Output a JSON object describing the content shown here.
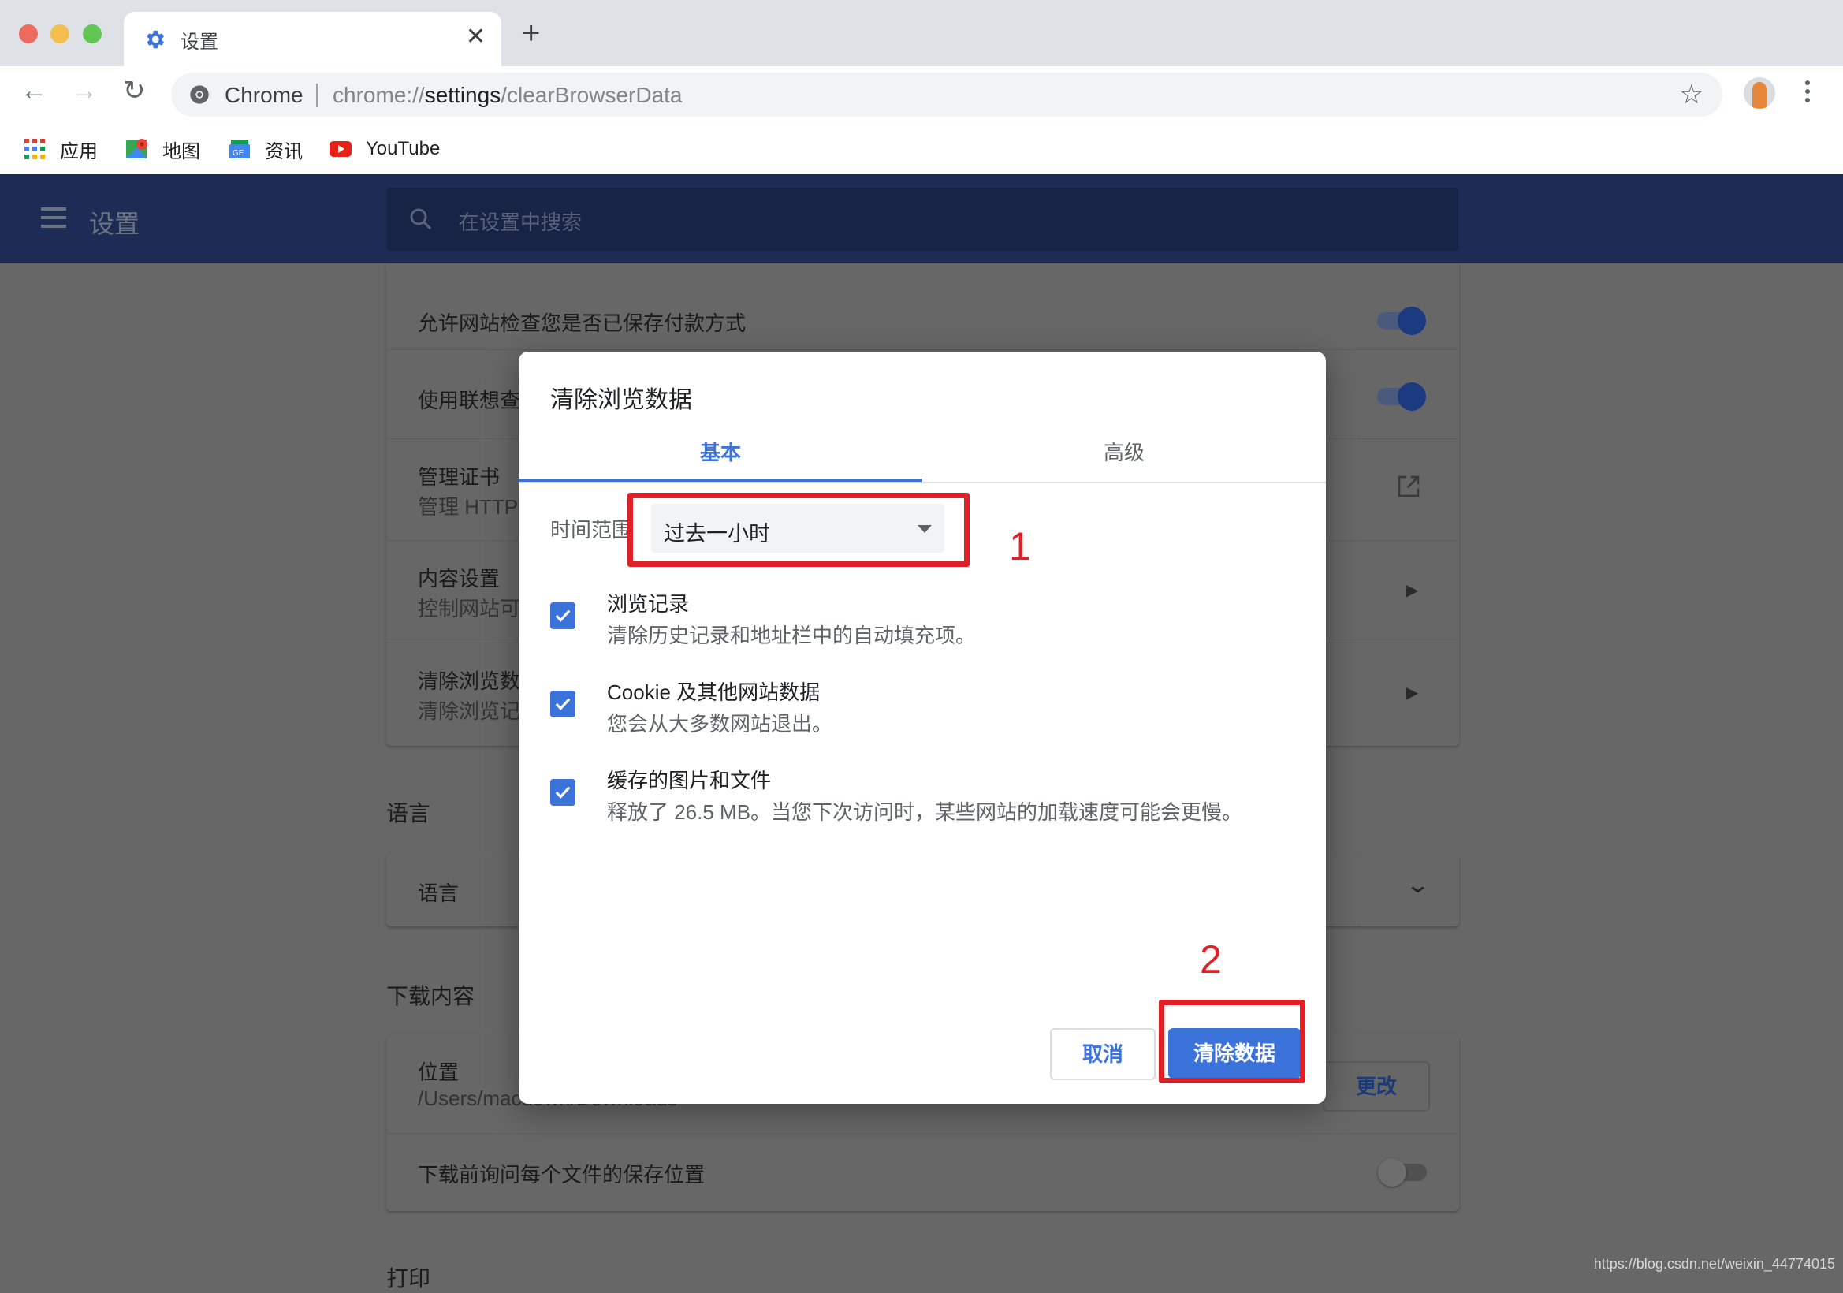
{
  "browser": {
    "tab": {
      "title": "设置",
      "icon": "gear-icon"
    },
    "new_tab_label": "+",
    "omnibox": {
      "site_label": "Chrome",
      "url_prefix": "chrome://",
      "url_host": "settings",
      "url_path": "/clearBrowserData"
    },
    "bookmarks": [
      {
        "label": "应用",
        "icon": "apps-grid-icon"
      },
      {
        "label": "地图",
        "icon": "maps-icon"
      },
      {
        "label": "资讯",
        "icon": "news-icon"
      },
      {
        "label": "YouTube",
        "icon": "youtube-icon"
      }
    ]
  },
  "settings": {
    "title": "设置",
    "search_placeholder": "在设置中搜索",
    "privacy_rows": [
      {
        "title": "允许网站检查您是否已保存付款方式",
        "control": "toggle",
        "on": true
      },
      {
        "title": "使用联想查询服务帮助完成搜索和网址",
        "control": "toggle",
        "on": true
      },
      {
        "title": "管理证书",
        "subtitle": "管理 HTTPS/SSL 证书和设置",
        "control": "external-link"
      },
      {
        "title": "内容设置",
        "subtitle": "控制网站可以使用和显示哪些信息",
        "control": "arrow"
      },
      {
        "title": "清除浏览数据",
        "subtitle": "清除浏览记录、Cookie、缓存及其他数据",
        "control": "arrow"
      }
    ],
    "language_section": {
      "heading": "语言",
      "row_title": "语言"
    },
    "downloads_section": {
      "heading": "下载内容",
      "location_title": "位置",
      "location_value": "/Users/macdown/Downloads",
      "change_button": "更改",
      "ask_title": "下载前询问每个文件的保存位置",
      "ask_on": false
    },
    "print_heading": "打印"
  },
  "dialog": {
    "title": "清除浏览数据",
    "tabs": [
      {
        "label": "基本",
        "active": true
      },
      {
        "label": "高级",
        "active": false
      }
    ],
    "time_range_label": "时间范围",
    "time_range_value": "过去一小时",
    "items": [
      {
        "title": "浏览记录",
        "subtitle": "清除历史记录和地址栏中的自动填充项。",
        "checked": true
      },
      {
        "title": "Cookie 及其他网站数据",
        "subtitle": "您会从大多数网站退出。",
        "checked": true
      },
      {
        "title": "缓存的图片和文件",
        "subtitle": "释放了 26.5 MB。当您下次访问时，某些网站的加载速度可能会更慢。",
        "checked": true
      }
    ],
    "cancel_label": "取消",
    "confirm_label": "清除数据"
  },
  "annotations": {
    "step1": "1",
    "step2": "2",
    "color": "#e01f26"
  },
  "colors": {
    "accent": "#3b73db",
    "header": "#1c2c54"
  },
  "watermark": "https://blog.csdn.net/weixin_44774015"
}
